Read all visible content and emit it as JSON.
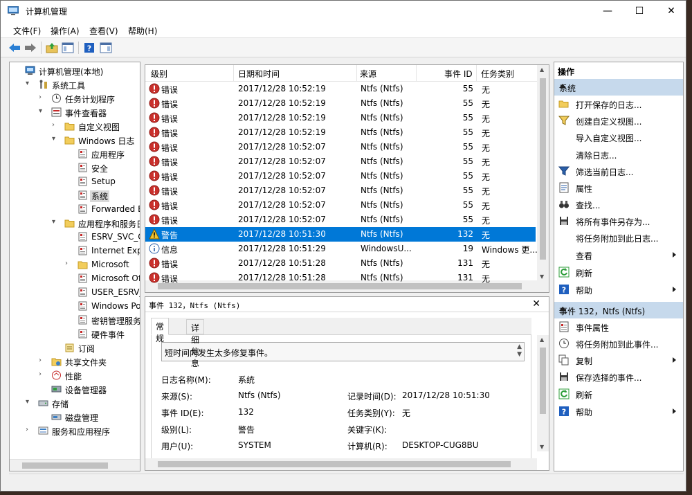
{
  "window": {
    "title": "计算机管理",
    "minimize": "—",
    "maximize": "☐",
    "close": "✕"
  },
  "menu": [
    "文件(F)",
    "操作(A)",
    "查看(V)",
    "帮助(H)"
  ],
  "tree": [
    {
      "label": "计算机管理(本地)",
      "depth": 0,
      "arrow": "",
      "icon": "computer-icon"
    },
    {
      "label": "系统工具",
      "depth": 1,
      "arrow": "▾",
      "icon": "tools-icon"
    },
    {
      "label": "任务计划程序",
      "depth": 2,
      "arrow": "›",
      "icon": "clock-icon"
    },
    {
      "label": "事件查看器",
      "depth": 2,
      "arrow": "▾",
      "icon": "event-viewer-icon"
    },
    {
      "label": "自定义视图",
      "depth": 3,
      "arrow": "›",
      "icon": "folder-icon"
    },
    {
      "label": "Windows 日志",
      "depth": 3,
      "arrow": "▾",
      "icon": "folder-icon"
    },
    {
      "label": "应用程序",
      "depth": 4,
      "arrow": "",
      "icon": "log-icon"
    },
    {
      "label": "安全",
      "depth": 4,
      "arrow": "",
      "icon": "log-icon"
    },
    {
      "label": "Setup",
      "depth": 4,
      "arrow": "",
      "icon": "log-icon"
    },
    {
      "label": "系统",
      "depth": 4,
      "arrow": "",
      "icon": "log-icon",
      "selected": true
    },
    {
      "label": "Forwarded Eve",
      "depth": 4,
      "arrow": "",
      "icon": "log-icon"
    },
    {
      "label": "应用程序和服务日志",
      "depth": 3,
      "arrow": "▾",
      "icon": "folder-icon"
    },
    {
      "label": "ESRV_SVC_QUE",
      "depth": 4,
      "arrow": "",
      "icon": "log-icon"
    },
    {
      "label": "Internet Explor",
      "depth": 4,
      "arrow": "",
      "icon": "log-icon"
    },
    {
      "label": "Microsoft",
      "depth": 4,
      "arrow": "›",
      "icon": "folder-icon"
    },
    {
      "label": "Microsoft Offic",
      "depth": 4,
      "arrow": "",
      "icon": "log-icon"
    },
    {
      "label": "USER_ESRV_SV",
      "depth": 4,
      "arrow": "",
      "icon": "log-icon"
    },
    {
      "label": "Windows Powe",
      "depth": 4,
      "arrow": "",
      "icon": "log-icon"
    },
    {
      "label": "密钥管理服务",
      "depth": 4,
      "arrow": "",
      "icon": "log-icon"
    },
    {
      "label": "硬件事件",
      "depth": 4,
      "arrow": "",
      "icon": "log-icon"
    },
    {
      "label": "订阅",
      "depth": 3,
      "arrow": "",
      "icon": "subscription-icon"
    },
    {
      "label": "共享文件夹",
      "depth": 2,
      "arrow": "›",
      "icon": "shared-folder-icon"
    },
    {
      "label": "性能",
      "depth": 2,
      "arrow": "›",
      "icon": "performance-icon"
    },
    {
      "label": "设备管理器",
      "depth": 2,
      "arrow": "",
      "icon": "device-manager-icon"
    },
    {
      "label": "存储",
      "depth": 1,
      "arrow": "▾",
      "icon": "storage-icon"
    },
    {
      "label": "磁盘管理",
      "depth": 2,
      "arrow": "",
      "icon": "disk-icon"
    },
    {
      "label": "服务和应用程序",
      "depth": 1,
      "arrow": "›",
      "icon": "services-icon"
    }
  ],
  "grid": {
    "columns": [
      "级别",
      "日期和时间",
      "来源",
      "事件 ID",
      "任务类别"
    ],
    "rows": [
      {
        "level": "错误",
        "type": "error",
        "datetime": "2017/12/28 10:52:19",
        "source": "Ntfs (Ntfs)",
        "id": "55",
        "category": "无"
      },
      {
        "level": "错误",
        "type": "error",
        "datetime": "2017/12/28 10:52:19",
        "source": "Ntfs (Ntfs)",
        "id": "55",
        "category": "无"
      },
      {
        "level": "错误",
        "type": "error",
        "datetime": "2017/12/28 10:52:19",
        "source": "Ntfs (Ntfs)",
        "id": "55",
        "category": "无"
      },
      {
        "level": "错误",
        "type": "error",
        "datetime": "2017/12/28 10:52:19",
        "source": "Ntfs (Ntfs)",
        "id": "55",
        "category": "无"
      },
      {
        "level": "错误",
        "type": "error",
        "datetime": "2017/12/28 10:52:07",
        "source": "Ntfs (Ntfs)",
        "id": "55",
        "category": "无"
      },
      {
        "level": "错误",
        "type": "error",
        "datetime": "2017/12/28 10:52:07",
        "source": "Ntfs (Ntfs)",
        "id": "55",
        "category": "无"
      },
      {
        "level": "错误",
        "type": "error",
        "datetime": "2017/12/28 10:52:07",
        "source": "Ntfs (Ntfs)",
        "id": "55",
        "category": "无"
      },
      {
        "level": "错误",
        "type": "error",
        "datetime": "2017/12/28 10:52:07",
        "source": "Ntfs (Ntfs)",
        "id": "55",
        "category": "无"
      },
      {
        "level": "错误",
        "type": "error",
        "datetime": "2017/12/28 10:52:07",
        "source": "Ntfs (Ntfs)",
        "id": "55",
        "category": "无"
      },
      {
        "level": "错误",
        "type": "error",
        "datetime": "2017/12/28 10:52:07",
        "source": "Ntfs (Ntfs)",
        "id": "55",
        "category": "无"
      },
      {
        "level": "警告",
        "type": "warning",
        "datetime": "2017/12/28 10:51:30",
        "source": "Ntfs (Ntfs)",
        "id": "132",
        "category": "无",
        "selected": true
      },
      {
        "level": "信息",
        "type": "info",
        "datetime": "2017/12/28 10:51:29",
        "source": "WindowsU...",
        "id": "19",
        "category": "Windows 更..."
      },
      {
        "level": "错误",
        "type": "error",
        "datetime": "2017/12/28 10:51:28",
        "source": "Ntfs (Ntfs)",
        "id": "131",
        "category": "无"
      },
      {
        "level": "错误",
        "type": "error",
        "datetime": "2017/12/28 10:51:28",
        "source": "Ntfs (Ntfs)",
        "id": "131",
        "category": "无"
      }
    ]
  },
  "detail": {
    "title": "事件 132，Ntfs (Ntfs)",
    "close": "✕",
    "tabs": [
      "常规",
      "详细信息"
    ],
    "description": "短时间内发生太多修复事件。",
    "fields": [
      {
        "label": "日志名称(M):",
        "value": "系统"
      },
      {
        "label": "来源(S):",
        "value": "Ntfs (Ntfs)",
        "label2": "记录时间(D):",
        "value2": "2017/12/28 10:51:30"
      },
      {
        "label": "事件 ID(E):",
        "value": "132",
        "label2": "任务类别(Y):",
        "value2": "无"
      },
      {
        "label": "级别(L):",
        "value": "警告",
        "label2": "关键字(K):",
        "value2": ""
      },
      {
        "label": "用户(U):",
        "value": "SYSTEM",
        "label2": "计算机(R):",
        "value2": "DESKTOP-CUG8BU"
      }
    ]
  },
  "actions": {
    "title": "操作",
    "section1": "系统",
    "items1": [
      {
        "label": "打开保存的日志...",
        "icon": "open-folder-icon"
      },
      {
        "label": "创建自定义视图...",
        "icon": "filter-create-icon"
      },
      {
        "label": "导入自定义视图...",
        "icon": ""
      },
      {
        "label": "清除日志...",
        "icon": ""
      },
      {
        "label": "筛选当前日志...",
        "icon": "filter-icon"
      },
      {
        "label": "属性",
        "icon": "properties-icon"
      },
      {
        "label": "查找...",
        "icon": "binoculars-icon"
      },
      {
        "label": "将所有事件另存为...",
        "icon": "save-icon"
      },
      {
        "label": "将任务附加到此日志...",
        "icon": ""
      },
      {
        "label": "查看",
        "icon": "",
        "submenu": true
      },
      {
        "label": "刷新",
        "icon": "refresh-icon"
      },
      {
        "label": "帮助",
        "icon": "help-icon",
        "submenu": true
      }
    ],
    "section2": "事件 132，Ntfs (Ntfs)",
    "items2": [
      {
        "label": "事件属性",
        "icon": "event-properties-icon"
      },
      {
        "label": "将任务附加到此事件...",
        "icon": "task-icon"
      },
      {
        "label": "复制",
        "icon": "copy-icon",
        "submenu": true
      },
      {
        "label": "保存选择的事件...",
        "icon": "save-icon"
      },
      {
        "label": "刷新",
        "icon": "refresh-icon"
      },
      {
        "label": "帮助",
        "icon": "help-icon",
        "submenu": true
      }
    ]
  }
}
